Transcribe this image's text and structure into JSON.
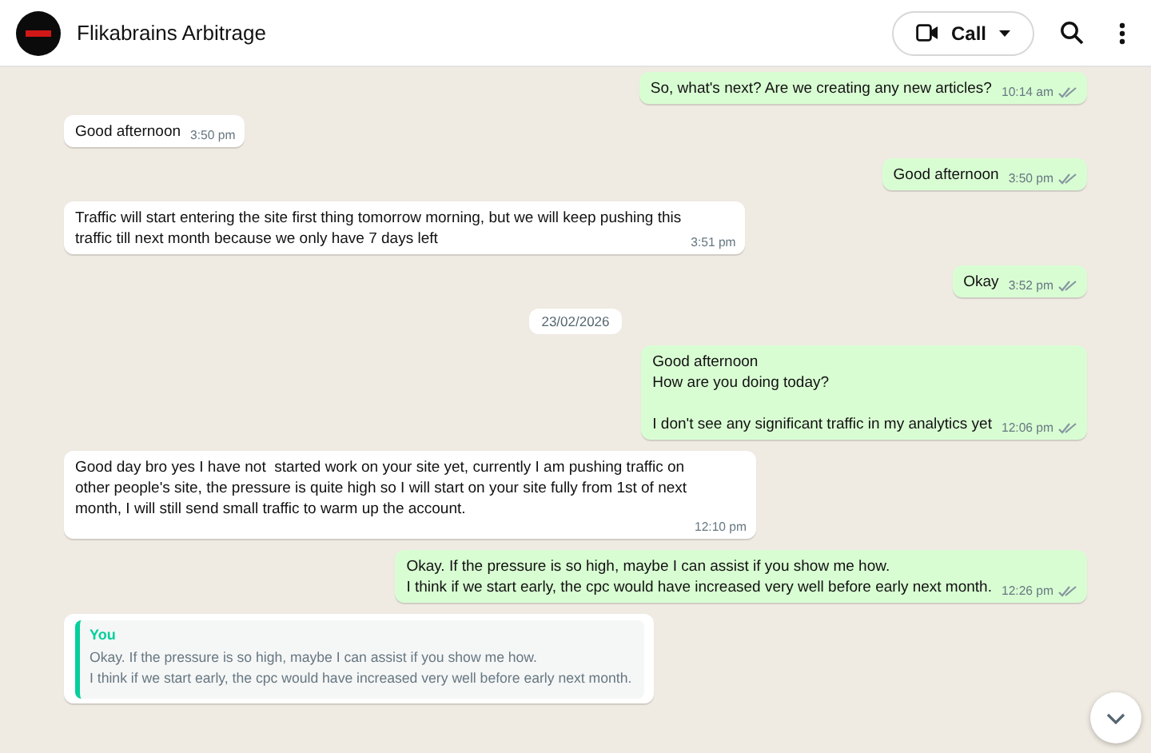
{
  "header": {
    "title": "Flikabrains Arbitrage",
    "call_label": "Call"
  },
  "messages": [
    {
      "kind": "out",
      "text": "So, what's next? Are we creating any new articles?",
      "time": "10:14 am"
    },
    {
      "kind": "in",
      "text": "Good afternoon",
      "time": "3:50 pm"
    },
    {
      "kind": "out",
      "text": "Good afternoon",
      "time": "3:50 pm"
    },
    {
      "kind": "in",
      "text": "Traffic will start entering the site first thing tomorrow morning, but we will keep pushing this\ntraffic till next month because we only have 7 days left",
      "time": "3:51 pm"
    },
    {
      "kind": "out",
      "text": "Okay",
      "time": "3:52 pm"
    },
    {
      "kind": "date",
      "text": "23/02/2026"
    },
    {
      "kind": "out",
      "text": "Good afternoon\nHow are you doing today?\n\nI don't see any significant traffic in my analytics yet",
      "time": "12:06 pm"
    },
    {
      "kind": "in",
      "text": "Good day bro yes I have not  started work on your site yet, currently I am pushing traffic on\nother people's site, the pressure is quite high so I will start on your site fully from 1st of next\nmonth, I will still send small traffic to warm up the account.",
      "time": "12:10 pm"
    },
    {
      "kind": "out",
      "text": "Okay. If the pressure is so high, maybe I can assist if you show me how.\nI think if we start early, the cpc would have increased very well before early next month.",
      "time": "12:26 pm"
    },
    {
      "kind": "in",
      "quote": {
        "author": "You",
        "text": "Okay. If the pressure is so high, maybe I can assist if you show me how.\nI think if we start early, the cpc would have increased very well before early next month."
      }
    }
  ]
}
